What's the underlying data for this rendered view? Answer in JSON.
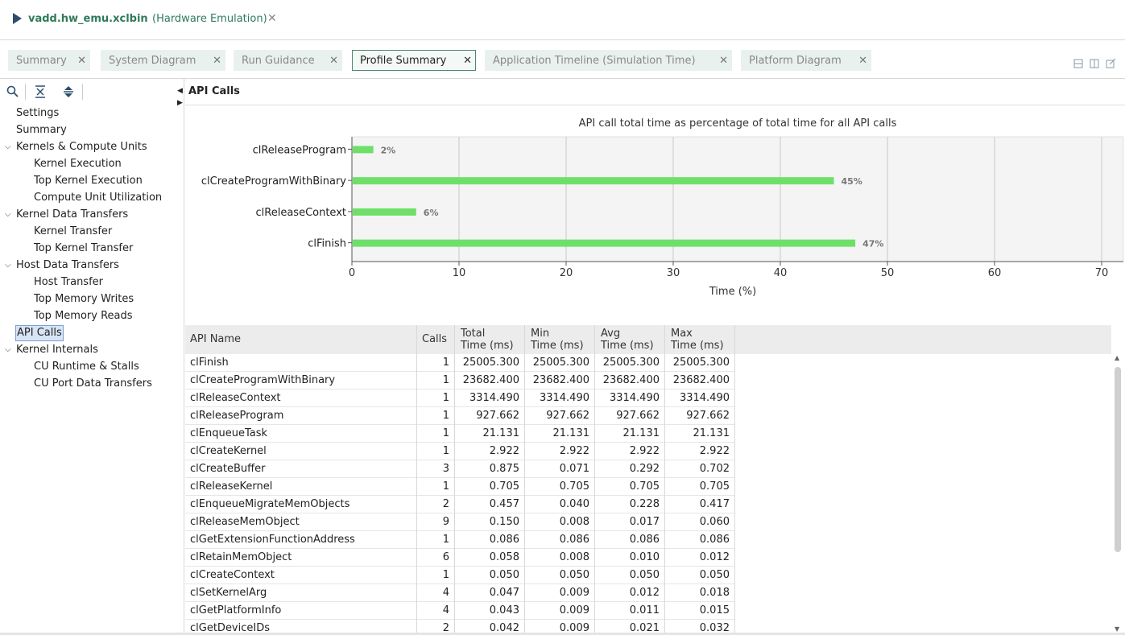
{
  "title": {
    "name": "vadd.hw_emu.xclbin",
    "mode": "(Hardware Emulation)"
  },
  "tabs": [
    {
      "label": "Summary"
    },
    {
      "label": "System Diagram"
    },
    {
      "label": "Run Guidance"
    },
    {
      "label": "Profile Summary"
    },
    {
      "label": "Application Timeline (Simulation Time)"
    },
    {
      "label": "Platform Diagram"
    }
  ],
  "active_tab": "Profile Summary",
  "tree": [
    {
      "label": "Settings",
      "level": 0
    },
    {
      "label": "Summary",
      "level": 0
    },
    {
      "label": "Kernels & Compute Units",
      "level": 0
    },
    {
      "label": "Kernel Execution",
      "level": 1
    },
    {
      "label": "Top Kernel Execution",
      "level": 1
    },
    {
      "label": "Compute Unit Utilization",
      "level": 1
    },
    {
      "label": "Kernel Data Transfers",
      "level": 0
    },
    {
      "label": "Kernel Transfer",
      "level": 1
    },
    {
      "label": "Top Kernel Transfer",
      "level": 1
    },
    {
      "label": "Host Data Transfers",
      "level": 0
    },
    {
      "label": "Host Transfer",
      "level": 1
    },
    {
      "label": "Top Memory Writes",
      "level": 1
    },
    {
      "label": "Top Memory Reads",
      "level": 1
    },
    {
      "label": "API Calls",
      "level": 0
    },
    {
      "label": "Kernel Internals",
      "level": 0
    },
    {
      "label": "CU Runtime & Stalls",
      "level": 1
    },
    {
      "label": "CU Port Data Transfers",
      "level": 1
    }
  ],
  "selected_tree_item": "API Calls",
  "section_title": "API Calls",
  "chart_data": {
    "type": "bar",
    "orientation": "horizontal",
    "title": "API call total time as percentage of total time for all API calls",
    "xlabel": "Time (%)",
    "ylabel": "",
    "categories": [
      "clReleaseProgram",
      "clCreateProgramWithBinary",
      "clReleaseContext",
      "clFinish"
    ],
    "values": [
      2,
      45,
      6,
      47
    ],
    "value_labels": [
      "2%",
      "45%",
      "6%",
      "47%"
    ],
    "xlim": [
      0,
      72
    ],
    "xticks": [
      0,
      10,
      20,
      30,
      40,
      50,
      60,
      70
    ],
    "grid": true,
    "bar_color": "#6ee06a"
  },
  "table": {
    "columns": [
      {
        "l1": "API Name",
        "l2": ""
      },
      {
        "l1": "Calls",
        "l2": ""
      },
      {
        "l1": "Total",
        "l2": "Time (ms)"
      },
      {
        "l1": "Min",
        "l2": "Time (ms)"
      },
      {
        "l1": "Avg",
        "l2": "Time (ms)"
      },
      {
        "l1": "Max",
        "l2": "Time (ms)"
      }
    ],
    "rows": [
      [
        "clFinish",
        "1",
        "25005.300",
        "25005.300",
        "25005.300",
        "25005.300"
      ],
      [
        "clCreateProgramWithBinary",
        "1",
        "23682.400",
        "23682.400",
        "23682.400",
        "23682.400"
      ],
      [
        "clReleaseContext",
        "1",
        "3314.490",
        "3314.490",
        "3314.490",
        "3314.490"
      ],
      [
        "clReleaseProgram",
        "1",
        "927.662",
        "927.662",
        "927.662",
        "927.662"
      ],
      [
        "clEnqueueTask",
        "1",
        "21.131",
        "21.131",
        "21.131",
        "21.131"
      ],
      [
        "clCreateKernel",
        "1",
        "2.922",
        "2.922",
        "2.922",
        "2.922"
      ],
      [
        "clCreateBuffer",
        "3",
        "0.875",
        "0.071",
        "0.292",
        "0.702"
      ],
      [
        "clReleaseKernel",
        "1",
        "0.705",
        "0.705",
        "0.705",
        "0.705"
      ],
      [
        "clEnqueueMigrateMemObjects",
        "2",
        "0.457",
        "0.040",
        "0.228",
        "0.417"
      ],
      [
        "clReleaseMemObject",
        "9",
        "0.150",
        "0.008",
        "0.017",
        "0.060"
      ],
      [
        "clGetExtensionFunctionAddress",
        "1",
        "0.086",
        "0.086",
        "0.086",
        "0.086"
      ],
      [
        "clRetainMemObject",
        "6",
        "0.058",
        "0.008",
        "0.010",
        "0.012"
      ],
      [
        "clCreateContext",
        "1",
        "0.050",
        "0.050",
        "0.050",
        "0.050"
      ],
      [
        "clSetKernelArg",
        "4",
        "0.047",
        "0.009",
        "0.012",
        "0.018"
      ],
      [
        "clGetPlatformInfo",
        "4",
        "0.043",
        "0.009",
        "0.011",
        "0.015"
      ],
      [
        "clGetDeviceIDs",
        "2",
        "0.042",
        "0.009",
        "0.021",
        "0.032"
      ]
    ]
  }
}
